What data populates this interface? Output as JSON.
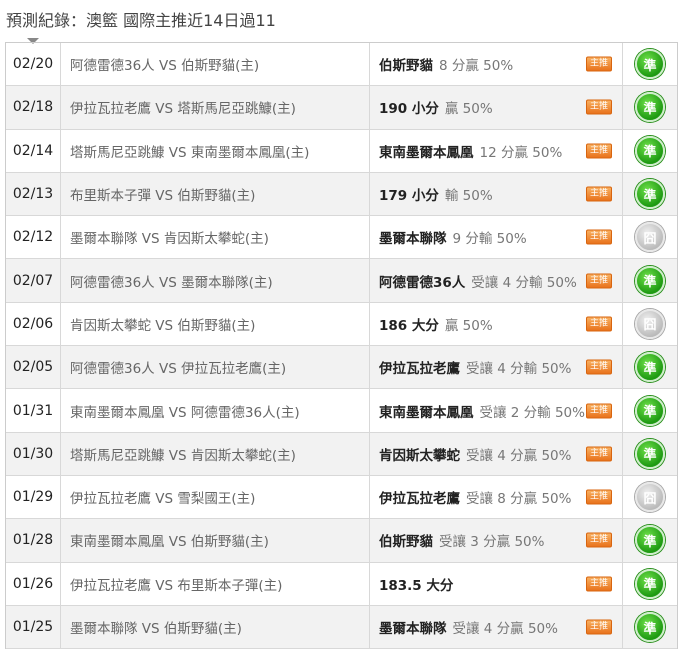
{
  "header": {
    "title": "預測紀錄：澳籃 國際主推近14日過11"
  },
  "badge_label": "主推",
  "colors": {
    "win": "#1e9a12",
    "push": "#b8b8b8",
    "badge": "#e9731d"
  },
  "rows": [
    {
      "date": "02/20",
      "match": "阿德雷德36人 VS 伯斯野貓(主)",
      "pick": "伯斯野貓",
      "detail": "8 分贏 50%",
      "result": "準",
      "status": "win"
    },
    {
      "date": "02/18",
      "match": "伊拉瓦拉老鷹 VS 塔斯馬尼亞跳鱇(主)",
      "pick": "190 小分",
      "detail": "贏 50%",
      "result": "準",
      "status": "win"
    },
    {
      "date": "02/14",
      "match": "塔斯馬尼亞跳鱇 VS 東南墨爾本鳳凰(主)",
      "pick": "東南墨爾本鳳凰",
      "detail": "12 分贏 50%",
      "result": "準",
      "status": "win"
    },
    {
      "date": "02/13",
      "match": "布里斯本子彈 VS 伯斯野貓(主)",
      "pick": "179 小分",
      "detail": "輸 50%",
      "result": "準",
      "status": "win"
    },
    {
      "date": "02/12",
      "match": "墨爾本聯隊 VS 肯因斯太攀蛇(主)",
      "pick": "墨爾本聯隊",
      "detail": "9 分輸 50%",
      "result": "囧",
      "status": "push"
    },
    {
      "date": "02/07",
      "match": "阿德雷德36人 VS 墨爾本聯隊(主)",
      "pick": "阿德雷德36人",
      "detail": "受讓 4 分輸 50%",
      "result": "準",
      "status": "win"
    },
    {
      "date": "02/06",
      "match": "肯因斯太攀蛇 VS 伯斯野貓(主)",
      "pick": "186 大分",
      "detail": "贏 50%",
      "result": "囧",
      "status": "push"
    },
    {
      "date": "02/05",
      "match": "阿德雷德36人 VS 伊拉瓦拉老鷹(主)",
      "pick": "伊拉瓦拉老鷹",
      "detail": "受讓 4 分輸 50%",
      "result": "準",
      "status": "win"
    },
    {
      "date": "01/31",
      "match": "東南墨爾本鳳凰 VS 阿德雷德36人(主)",
      "pick": "東南墨爾本鳳凰",
      "detail": "受讓 2 分輸 50%",
      "result": "準",
      "status": "win"
    },
    {
      "date": "01/30",
      "match": "塔斯馬尼亞跳鱇 VS 肯因斯太攀蛇(主)",
      "pick": "肯因斯太攀蛇",
      "detail": "受讓 4 分贏 50%",
      "result": "準",
      "status": "win"
    },
    {
      "date": "01/29",
      "match": "伊拉瓦拉老鷹 VS 雪梨國王(主)",
      "pick": "伊拉瓦拉老鷹",
      "detail": "受讓 8 分贏 50%",
      "result": "囧",
      "status": "push"
    },
    {
      "date": "01/28",
      "match": "東南墨爾本鳳凰 VS 伯斯野貓(主)",
      "pick": "伯斯野貓",
      "detail": "受讓 3 分贏 50%",
      "result": "準",
      "status": "win"
    },
    {
      "date": "01/26",
      "match": "伊拉瓦拉老鷹 VS 布里斯本子彈(主)",
      "pick": "183.5 大分",
      "detail": "",
      "result": "準",
      "status": "win"
    },
    {
      "date": "01/25",
      "match": "墨爾本聯隊 VS 伯斯野貓(主)",
      "pick": "墨爾本聯隊",
      "detail": "受讓 4 分贏 50%",
      "result": "準",
      "status": "win"
    }
  ]
}
